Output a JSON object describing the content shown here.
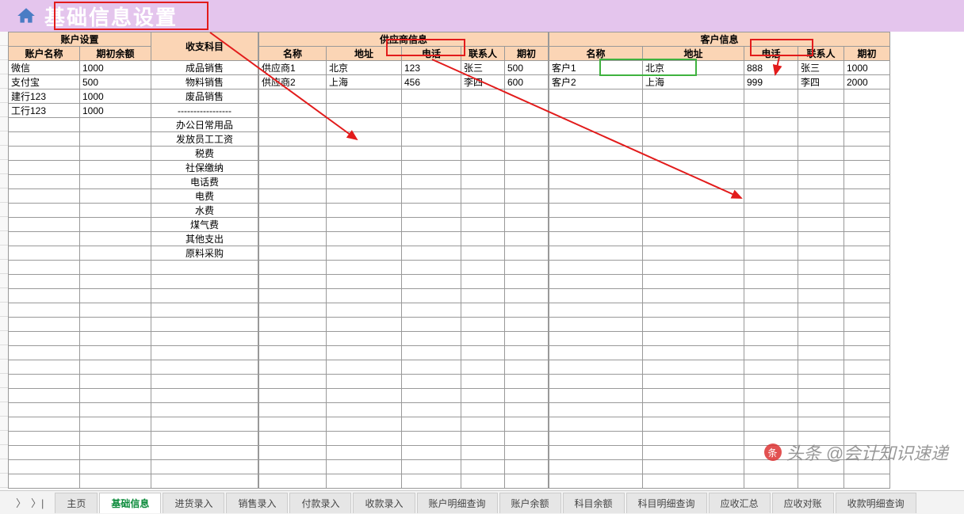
{
  "title": "基础信息设置",
  "sections": {
    "account": {
      "group": "账户设置",
      "name": "账户名称",
      "balance": "期初余额"
    },
    "subject": "收支科目",
    "supplier": {
      "group": "供应商信息",
      "name": "名称",
      "addr": "地址",
      "tel": "电话",
      "contact": "联系人",
      "init": "期初"
    },
    "customer": {
      "group": "客户信息",
      "name": "名称",
      "addr": "地址",
      "tel": "电话",
      "contact": "联系人",
      "init": "期初"
    }
  },
  "accounts": [
    {
      "name": "微信",
      "balance": "1000"
    },
    {
      "name": "支付宝",
      "balance": "500"
    },
    {
      "name": "建行123",
      "balance": "1000"
    },
    {
      "name": "工行123",
      "balance": "1000"
    }
  ],
  "subjects": [
    "成品销售",
    "物料销售",
    "废品销售",
    "-----------------",
    "办公日常用品",
    "发放员工工资",
    "税费",
    "社保缴纳",
    "电话费",
    "电费",
    "水费",
    "煤气费",
    "其他支出",
    "原料采购"
  ],
  "suppliers": [
    {
      "name": "供应商1",
      "addr": "北京",
      "tel": "123",
      "contact": "张三",
      "init": "500"
    },
    {
      "name": "供应商2",
      "addr": "上海",
      "tel": "456",
      "contact": "李四",
      "init": "600"
    }
  ],
  "customers": [
    {
      "name": "客户1",
      "addr": "北京",
      "tel": "888",
      "contact": "张三",
      "init": "1000"
    },
    {
      "name": "客户2",
      "addr": "上海",
      "tel": "999",
      "contact": "李四",
      "init": "2000"
    }
  ],
  "tabs": [
    "主页",
    "基础信息",
    "进货录入",
    "销售录入",
    "付款录入",
    "收款录入",
    "账户明细查询",
    "账户余额",
    "科目余额",
    "科目明细查询",
    "应收汇总",
    "应收对账",
    "收款明细查询"
  ],
  "active_tab": "基础信息",
  "watermark": "头条 @会计知识速递",
  "nav": {
    "prev": "〉",
    "last": "〉|"
  }
}
